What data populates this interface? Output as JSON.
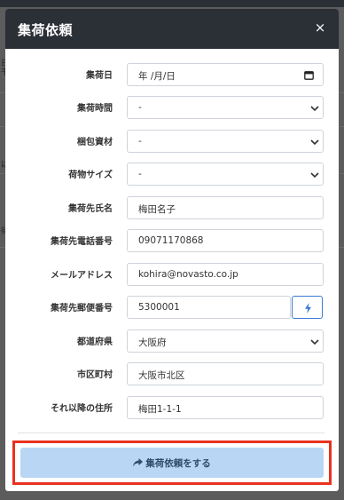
{
  "background": {
    "edge_texts": [
      "日",
      "千",
      "は",
      "待"
    ]
  },
  "modal": {
    "title": "集荷依頼",
    "close_glyph": "×"
  },
  "form": {
    "pickup_date": {
      "label": "集荷日",
      "placeholder": "年 /月/日"
    },
    "pickup_time": {
      "label": "集荷時間",
      "value": "-"
    },
    "packing_material": {
      "label": "梱包資材",
      "value": "-"
    },
    "package_size": {
      "label": "荷物サイズ",
      "value": "-"
    },
    "name": {
      "label": "集荷先氏名",
      "value": "梅田名子"
    },
    "phone": {
      "label": "集荷先電話番号",
      "value": "09071170868"
    },
    "email": {
      "label": "メールアドレス",
      "value": "kohira@novasto.co.jp"
    },
    "postal_code": {
      "label": "集荷先郵便番号",
      "value": "5300001"
    },
    "prefecture": {
      "label": "都道府県",
      "value": "大阪府"
    },
    "city": {
      "label": "市区町村",
      "value": "大阪市北区"
    },
    "address_rest": {
      "label": "それ以降の住所",
      "value": "梅田1-1-1"
    }
  },
  "submit": {
    "label": "集荷依頼をする",
    "icon": "share-arrow-icon"
  },
  "colors": {
    "header_bg": "#2b2f36",
    "submit_bg": "#b9d7f4",
    "highlight_border": "#e8321f",
    "accent_blue": "#3a7bd5"
  }
}
